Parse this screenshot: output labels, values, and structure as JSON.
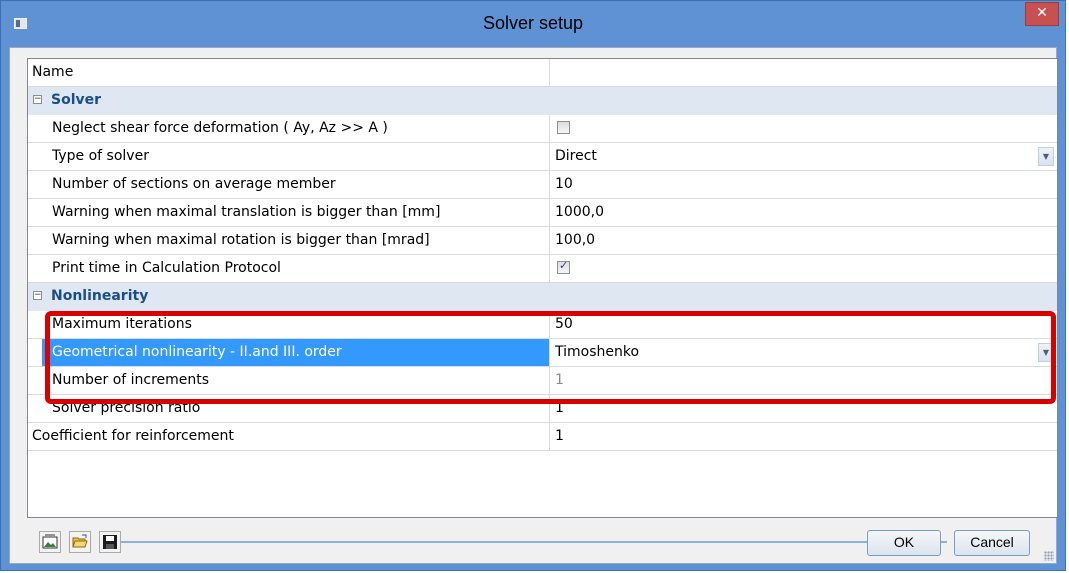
{
  "window": {
    "title": "Solver setup",
    "close_label": "✕"
  },
  "grid": {
    "name_row": {
      "label": "Name",
      "value": ""
    },
    "solver_category": {
      "label": "Solver",
      "rows": [
        {
          "label": "Neglect shear force deformation ( Ay, Az >> A )",
          "type": "checkbox",
          "checked": false
        },
        {
          "label": "Type of solver",
          "type": "dropdown",
          "value": "Direct"
        },
        {
          "label": "Number of sections on average member",
          "type": "text",
          "value": "10"
        },
        {
          "label": "Warning when maximal translation is bigger than [mm]",
          "type": "text",
          "value": "1000,0"
        },
        {
          "label": "Warning when maximal rotation is bigger than [mrad]",
          "type": "text",
          "value": "100,0"
        },
        {
          "label": "Print time in Calculation Protocol",
          "type": "checkbox",
          "checked": true
        }
      ]
    },
    "nonlinearity_category": {
      "label": "Nonlinearity",
      "rows": [
        {
          "label": "Maximum iterations",
          "type": "text",
          "value": "50"
        },
        {
          "label": "Geometrical nonlinearity - II.and III. order",
          "type": "dropdown",
          "value": "Timoshenko",
          "selected": true
        },
        {
          "label": "Number of increments",
          "type": "text",
          "value": "1",
          "disabled": true
        },
        {
          "label": "Solver precision ratio",
          "type": "text",
          "value": "1"
        }
      ]
    },
    "reinforcement_row": {
      "label": "Coefficient for reinforcement",
      "value": "1"
    }
  },
  "footer": {
    "ok_label": "OK",
    "cancel_label": "Cancel",
    "tools": [
      "image-export-icon",
      "open-folder-icon",
      "save-disk-icon"
    ]
  },
  "colors": {
    "highlight": "#d90000",
    "selection": "#3399ff",
    "category_text": "#1a4d8a",
    "title_bar": "#5f92d4"
  }
}
